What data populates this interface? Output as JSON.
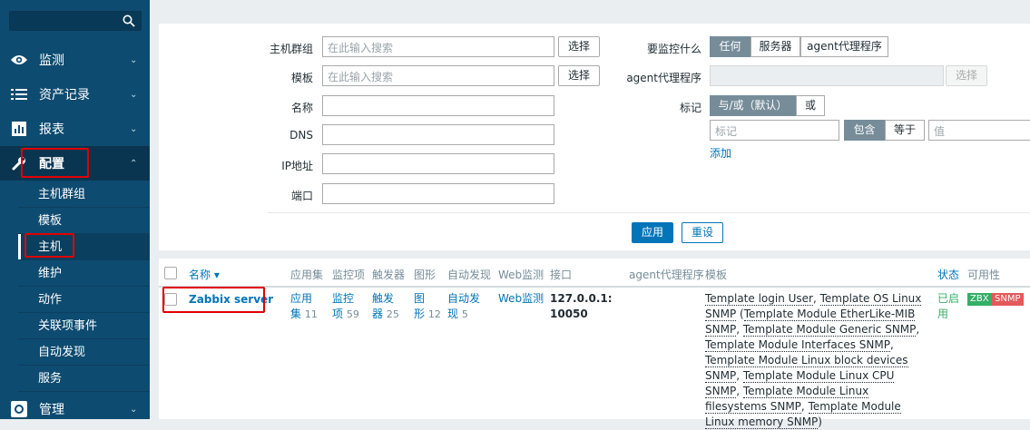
{
  "sidebar": {
    "search": {
      "placeholder": ""
    },
    "menu": [
      {
        "label": "监测",
        "icon": "eye-icon"
      },
      {
        "label": "资产记录",
        "icon": "list-icon"
      },
      {
        "label": "报表",
        "icon": "bar-chart-icon"
      },
      {
        "label": "配置",
        "icon": "wrench-icon"
      },
      {
        "label": "管理",
        "icon": "gear-icon"
      }
    ],
    "submenu": [
      {
        "label": "主机群组"
      },
      {
        "label": "模板"
      },
      {
        "label": "主机"
      },
      {
        "label": "维护"
      },
      {
        "label": "动作"
      },
      {
        "label": "关联项事件"
      },
      {
        "label": "自动发现"
      },
      {
        "label": "服务"
      }
    ]
  },
  "filter": {
    "host_groups": {
      "label": "主机群组",
      "placeholder": "在此输入搜索",
      "button": "选择"
    },
    "templates": {
      "label": "模板",
      "placeholder": "在此输入搜索",
      "button": "选择"
    },
    "name": {
      "label": "名称",
      "value": ""
    },
    "dns": {
      "label": "DNS",
      "value": ""
    },
    "ip": {
      "label": "IP地址",
      "value": ""
    },
    "port": {
      "label": "端口",
      "value": ""
    },
    "monitored_by": {
      "label": "要监控什么",
      "options": [
        "任何",
        "服务器",
        "agent代理程序"
      ],
      "selected": "任何"
    },
    "proxy": {
      "label": "agent代理程序",
      "button": "选择"
    },
    "tags": {
      "label": "标记",
      "eval_options": [
        "与/或（默认）",
        "或"
      ],
      "tag_placeholder": "标记",
      "operator_options": [
        "包含",
        "等于"
      ],
      "value_placeholder": "值",
      "add_link": "添加"
    },
    "apply_button": "应用",
    "reset_button": "重设"
  },
  "table": {
    "headers": {
      "name": "名称 ▾",
      "applications": "应用集",
      "items": "监控项",
      "triggers": "触发器",
      "graphs": "图形",
      "discovery": "自动发现",
      "web": "Web监测",
      "interface": "接口",
      "proxy": "agent代理程序",
      "templates": "模板",
      "status": "状态",
      "availability": "可用性"
    },
    "rows": [
      {
        "name": "Zabbix server",
        "applications": {
          "line1": "应用",
          "line2": "集",
          "count": "11"
        },
        "items": {
          "line1": "监控",
          "line2": "项",
          "count": "59"
        },
        "triggers": {
          "line1": "触发",
          "line2": "器",
          "count": "25"
        },
        "graphs": {
          "line1": "图",
          "line2": "形",
          "count": "12"
        },
        "discovery": {
          "line1": "自动发",
          "line2": "现",
          "count": "5"
        },
        "web": "Web监测",
        "interface": {
          "line1": "127.0.0.1:",
          "line2": "10050"
        },
        "templates": [
          "Template login User",
          "Template OS Linux SNMP",
          "Template Module EtherLike-MIB SNMP",
          "Template Module Generic SNMP",
          "Template Module Interfaces SNMP",
          "Template Module Linux block devices SNMP",
          "Template Module Linux CPU SNMP",
          "Template Module Linux filesystems SNMP",
          "Template Module Linux memory SNMP"
        ],
        "status": {
          "line1": "已启",
          "line2": "用"
        },
        "availability": [
          {
            "label": "ZBX",
            "color": "#34af67"
          },
          {
            "label": "SNMP",
            "color": "#e45959"
          }
        ]
      }
    ]
  },
  "colors": {
    "sidebar_bg": "#0e4b70",
    "link": "#0275b8",
    "enabled": "#34af67",
    "highlight_box": "#e10000"
  }
}
